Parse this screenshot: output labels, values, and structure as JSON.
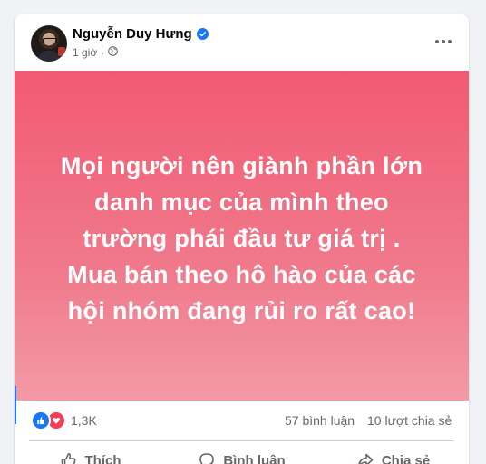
{
  "post": {
    "author": "Nguyễn Duy Hưng",
    "verified": true,
    "timestamp": "1 giờ",
    "privacy_icon": "globe-icon",
    "text": "Mọi người nên giành phần lớn\ndanh mục của mình theo\ntrường phái đầu tư giá trị .\nMua bán theo hô hào của các\nhội nhóm đang rủi ro rất cao!",
    "background_colors": [
      "#f25a72",
      "#f29aa6"
    ],
    "text_color": "#ffffff"
  },
  "stats": {
    "reactions": [
      "like-icon",
      "love-icon"
    ],
    "reaction_count": "1,3K",
    "comments": "57 bình luận",
    "shares": "10 lượt chia sẻ"
  },
  "actions": {
    "like_label": "Thích",
    "comment_label": "Bình luận",
    "share_label": "Chia sẻ"
  },
  "colors": {
    "brand": "#1877f2",
    "love": "#f33e58",
    "secondary_text": "#65676b"
  }
}
